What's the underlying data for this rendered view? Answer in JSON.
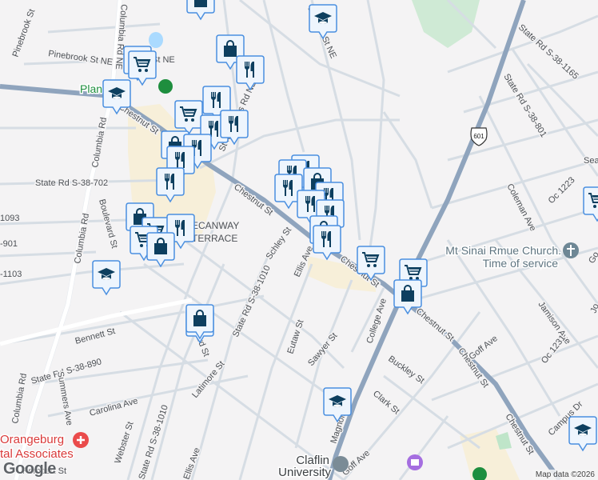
{
  "map": {
    "streets": {
      "pinebrook_st": "Pinebrook St",
      "pinebrook_st_ne": "Pinebrook St NE",
      "st_ne": "St NE",
      "columbia_rd_ne": "Columbia Rd NE",
      "columbia_rd": "Columbia Rd",
      "st_matthews": "St Matthews Rd NE",
      "chestnut_st": "Chestnut St",
      "sr_702": "State Rd S-38-702",
      "sr_1093": "1093",
      "sr_901": "-901",
      "sr_1103": "-1103",
      "boulevard_st": "Boulevard St",
      "ecanway": "ECANWAY",
      "terrace": "TERRACE",
      "schley_st": "Schley St",
      "ellis_ave": "Ellis Ave",
      "sr_1010": "State Rd S-38-1010",
      "bennett_st": "Bennett St",
      "sr_890": "State Rd S-38-890",
      "summers_ave": "Summers Ave",
      "carolina_ave": "Carolina Ave",
      "latimore_st": "Latimore St",
      "eutaw_st": "Eutaw St",
      "sawyer_st": "Sawyer St",
      "college_ave": "College Ave",
      "buckley_st": "Buckley St",
      "clark_st": "Clark St",
      "magnolia_st": "Magnolia St",
      "goff_ave": "Goff Ave",
      "jamison_ave": "Jamison Ave",
      "oc_1231": "Oc 1231",
      "oc_1223": "Oc 1223",
      "campus_dr": "Campus Dr",
      "coleman_ave": "Coleman Ave",
      "sr_1165": "State Rd S-38-1165",
      "sr_801": "State Rd S-38-801",
      "decatur_st": "Decatur St NE",
      "webster_st": "Webster St",
      "pembert_st": "Pembert St",
      "sea": "Sea",
      "go": "Go",
      "jo": "Jo"
    },
    "route_shield": "601",
    "pois": {
      "church_line1": "Mt Sinai Rmue Church.",
      "church_line2": "Time of service",
      "hospital_line1": "Orangeburg",
      "hospital_line2": "tal Associates",
      "university_line1": "Claflin",
      "university_line2": "University",
      "planet": "Plan"
    },
    "markers": [
      "bag",
      "grad",
      "cart",
      "cart",
      "bag",
      "fork",
      "grad",
      "fork",
      "cart",
      "fork",
      "fork",
      "bag",
      "fork",
      "fork",
      "fork",
      "fork",
      "fork",
      "fork",
      "bag",
      "fork",
      "fork",
      "fork",
      "bag",
      "fork",
      "cart",
      "bag",
      "cart",
      "cart",
      "fork",
      "bag",
      "grad",
      "bag",
      "bag",
      "cart",
      "cart",
      "bag",
      "grad",
      "grad"
    ],
    "attribution": "Map data ©2026",
    "logo": "Google",
    "colors": {
      "marker_border": "#4a8fe0",
      "marker_icon": "#0d3f5f",
      "highway": "#8fa4bd",
      "road": "#d3dbe3"
    }
  }
}
